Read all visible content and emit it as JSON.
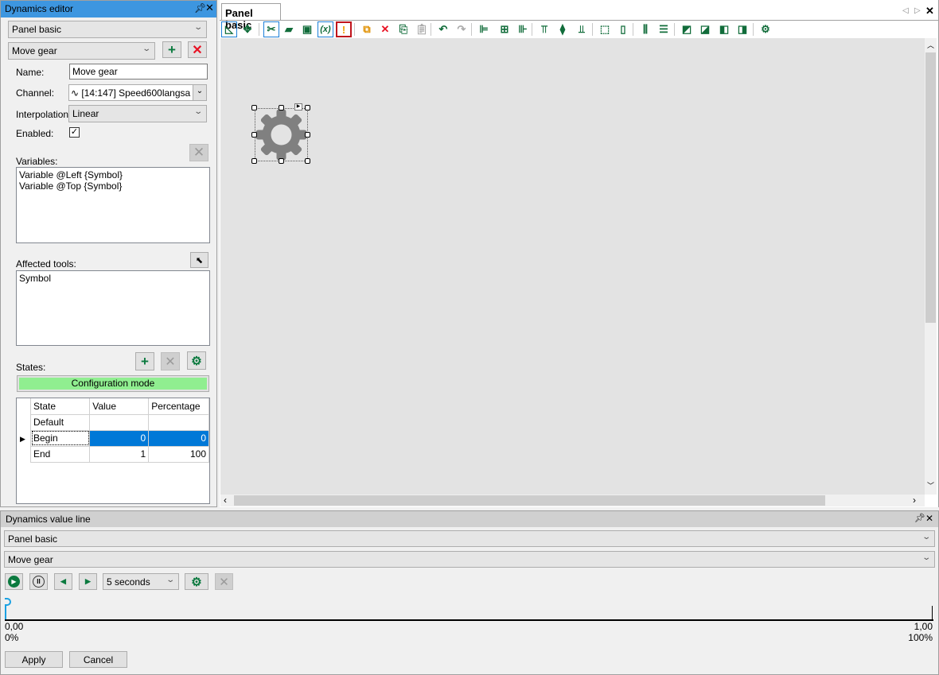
{
  "editor": {
    "title": "Dynamics editor",
    "panel_select": "Panel basic",
    "dynamic_select": "Move gear",
    "name_label": "Name:",
    "name_value": "Move gear",
    "channel_label": "Channel:",
    "channel_value": "[14:147] Speed600langsa",
    "interpolation_label": "Interpolation:",
    "interpolation_value": "Linear",
    "enabled_label": "Enabled:",
    "enabled": true,
    "variables_label": "Variables:",
    "variables": [
      "Variable @Left {Symbol}",
      "Variable @Top {Symbol}"
    ],
    "affected_label": "Affected tools:",
    "affected": [
      "Symbol"
    ],
    "states_label": "States:",
    "config_mode": "Configuration mode",
    "table": {
      "headers": [
        "State",
        "Value",
        "Percentage"
      ],
      "rows": [
        [
          "Default",
          "",
          ""
        ],
        [
          "Begin",
          "0",
          "0"
        ],
        [
          "End",
          "1",
          "100"
        ]
      ],
      "selected_row": 1
    }
  },
  "document": {
    "tab": "Panel basic"
  },
  "toolbar": [
    "draw-mode",
    "move",
    "tools",
    "book",
    "settings-window",
    "variable",
    "value-marker",
    "group",
    "delete",
    "copy",
    "paste",
    "undo",
    "redo",
    "align-left",
    "align-center",
    "align-right",
    "align-top",
    "align-middle",
    "align-bottom",
    "same-width",
    "same-height",
    "distribute-h",
    "distribute-v",
    "bring-front",
    "bring-forward",
    "send-back",
    "send-backward",
    "settings"
  ],
  "valueline": {
    "title": "Dynamics value line",
    "panel_select": "Panel basic",
    "dynamic_select": "Move gear",
    "duration": "5 seconds",
    "min_value": "0,00",
    "min_pct": "0%",
    "max_value": "1,00",
    "max_pct": "100%",
    "position": 0,
    "apply": "Apply",
    "cancel": "Cancel"
  },
  "colors": {
    "accent": "#0078d7",
    "green": "#0b7a3f",
    "config": "#90ee90"
  }
}
